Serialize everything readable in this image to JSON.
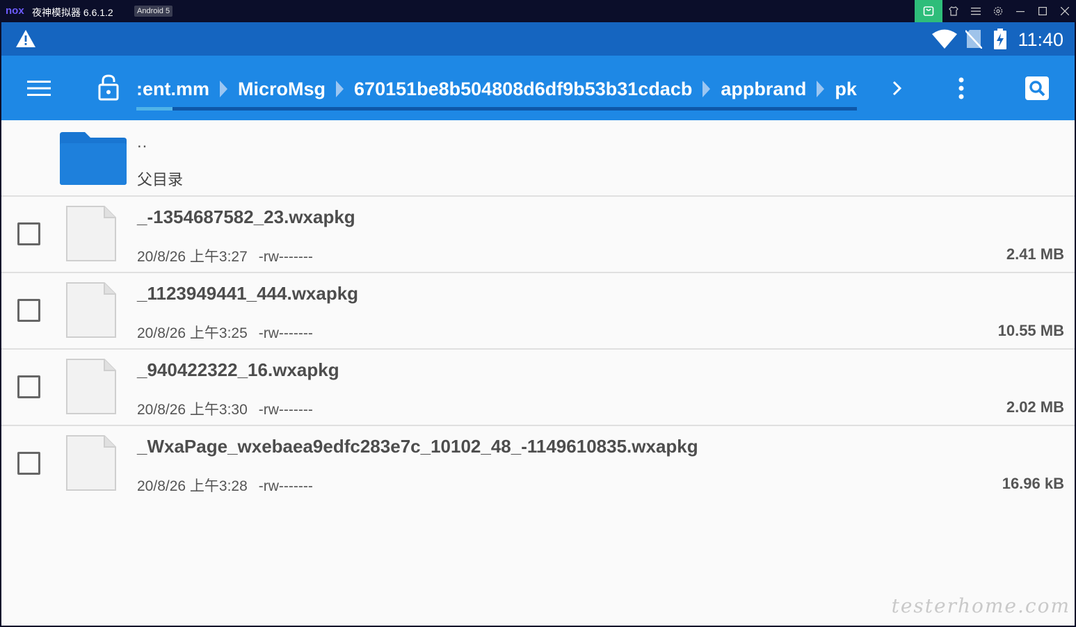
{
  "window": {
    "logo_text": "nox",
    "title": "夜神模拟器 6.6.1.2",
    "android_badge": "Android 5"
  },
  "status_bar": {
    "time": "11:40"
  },
  "toolbar": {
    "breadcrumbs": [
      ":ent.mm",
      "MicroMsg",
      "670151be8b504808d6df9b53b31cdacb",
      "appbrand",
      "pkg"
    ],
    "accent_color": "#1e88e5",
    "status_color": "#1565c0"
  },
  "parent_dir": {
    "dots": "..",
    "label": "父目录"
  },
  "files": [
    {
      "name": "_-1354687582_23.wxapkg",
      "date": "20/8/26 上午3:27",
      "perm": "-rw-------",
      "size": "2.41 MB"
    },
    {
      "name": "_1123949441_444.wxapkg",
      "date": "20/8/26 上午3:25",
      "perm": "-rw-------",
      "size": "10.55 MB"
    },
    {
      "name": "_940422322_16.wxapkg",
      "date": "20/8/26 上午3:30",
      "perm": "-rw-------",
      "size": "2.02 MB"
    },
    {
      "name": "_WxaPage_wxebaea9edfc283e7c_10102_48_-1149610835.wxapkg",
      "date": "20/8/26 上午3:28",
      "perm": "-rw-------",
      "size": "16.96 kB"
    }
  ],
  "watermark": "testerhome.com"
}
